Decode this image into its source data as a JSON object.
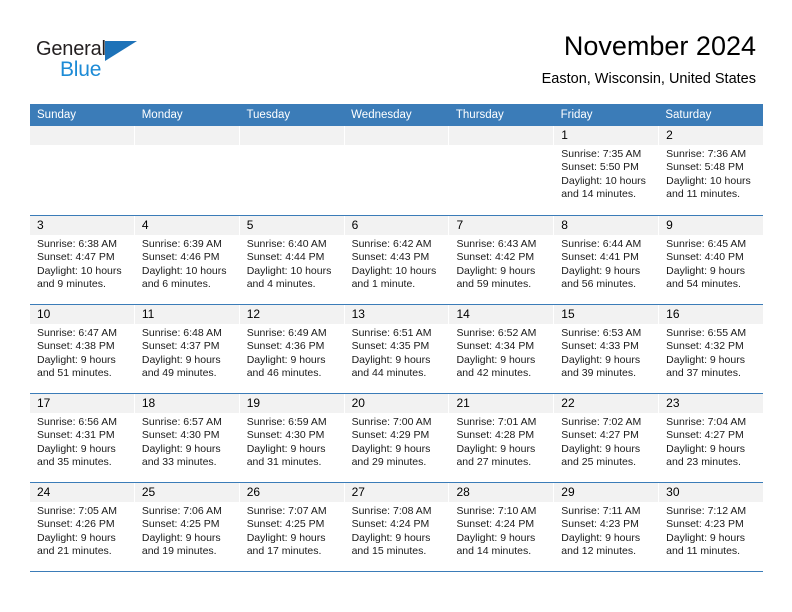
{
  "brand": {
    "name_dark": "General",
    "name_blue": "Blue",
    "accent_color": "#1d8bd6",
    "header_color": "#3b7cb8"
  },
  "header": {
    "title": "November 2024",
    "subtitle": "Easton, Wisconsin, United States"
  },
  "calendar": {
    "weekdays": [
      "Sunday",
      "Monday",
      "Tuesday",
      "Wednesday",
      "Thursday",
      "Friday",
      "Saturday"
    ],
    "weeks": [
      [
        {
          "day": "",
          "sunrise": "",
          "sunset": "",
          "daylight": ""
        },
        {
          "day": "",
          "sunrise": "",
          "sunset": "",
          "daylight": ""
        },
        {
          "day": "",
          "sunrise": "",
          "sunset": "",
          "daylight": ""
        },
        {
          "day": "",
          "sunrise": "",
          "sunset": "",
          "daylight": ""
        },
        {
          "day": "",
          "sunrise": "",
          "sunset": "",
          "daylight": ""
        },
        {
          "day": "1",
          "sunrise": "Sunrise: 7:35 AM",
          "sunset": "Sunset: 5:50 PM",
          "daylight": "Daylight: 10 hours and 14 minutes."
        },
        {
          "day": "2",
          "sunrise": "Sunrise: 7:36 AM",
          "sunset": "Sunset: 5:48 PM",
          "daylight": "Daylight: 10 hours and 11 minutes."
        }
      ],
      [
        {
          "day": "3",
          "sunrise": "Sunrise: 6:38 AM",
          "sunset": "Sunset: 4:47 PM",
          "daylight": "Daylight: 10 hours and 9 minutes."
        },
        {
          "day": "4",
          "sunrise": "Sunrise: 6:39 AM",
          "sunset": "Sunset: 4:46 PM",
          "daylight": "Daylight: 10 hours and 6 minutes."
        },
        {
          "day": "5",
          "sunrise": "Sunrise: 6:40 AM",
          "sunset": "Sunset: 4:44 PM",
          "daylight": "Daylight: 10 hours and 4 minutes."
        },
        {
          "day": "6",
          "sunrise": "Sunrise: 6:42 AM",
          "sunset": "Sunset: 4:43 PM",
          "daylight": "Daylight: 10 hours and 1 minute."
        },
        {
          "day": "7",
          "sunrise": "Sunrise: 6:43 AM",
          "sunset": "Sunset: 4:42 PM",
          "daylight": "Daylight: 9 hours and 59 minutes."
        },
        {
          "day": "8",
          "sunrise": "Sunrise: 6:44 AM",
          "sunset": "Sunset: 4:41 PM",
          "daylight": "Daylight: 9 hours and 56 minutes."
        },
        {
          "day": "9",
          "sunrise": "Sunrise: 6:45 AM",
          "sunset": "Sunset: 4:40 PM",
          "daylight": "Daylight: 9 hours and 54 minutes."
        }
      ],
      [
        {
          "day": "10",
          "sunrise": "Sunrise: 6:47 AM",
          "sunset": "Sunset: 4:38 PM",
          "daylight": "Daylight: 9 hours and 51 minutes."
        },
        {
          "day": "11",
          "sunrise": "Sunrise: 6:48 AM",
          "sunset": "Sunset: 4:37 PM",
          "daylight": "Daylight: 9 hours and 49 minutes."
        },
        {
          "day": "12",
          "sunrise": "Sunrise: 6:49 AM",
          "sunset": "Sunset: 4:36 PM",
          "daylight": "Daylight: 9 hours and 46 minutes."
        },
        {
          "day": "13",
          "sunrise": "Sunrise: 6:51 AM",
          "sunset": "Sunset: 4:35 PM",
          "daylight": "Daylight: 9 hours and 44 minutes."
        },
        {
          "day": "14",
          "sunrise": "Sunrise: 6:52 AM",
          "sunset": "Sunset: 4:34 PM",
          "daylight": "Daylight: 9 hours and 42 minutes."
        },
        {
          "day": "15",
          "sunrise": "Sunrise: 6:53 AM",
          "sunset": "Sunset: 4:33 PM",
          "daylight": "Daylight: 9 hours and 39 minutes."
        },
        {
          "day": "16",
          "sunrise": "Sunrise: 6:55 AM",
          "sunset": "Sunset: 4:32 PM",
          "daylight": "Daylight: 9 hours and 37 minutes."
        }
      ],
      [
        {
          "day": "17",
          "sunrise": "Sunrise: 6:56 AM",
          "sunset": "Sunset: 4:31 PM",
          "daylight": "Daylight: 9 hours and 35 minutes."
        },
        {
          "day": "18",
          "sunrise": "Sunrise: 6:57 AM",
          "sunset": "Sunset: 4:30 PM",
          "daylight": "Daylight: 9 hours and 33 minutes."
        },
        {
          "day": "19",
          "sunrise": "Sunrise: 6:59 AM",
          "sunset": "Sunset: 4:30 PM",
          "daylight": "Daylight: 9 hours and 31 minutes."
        },
        {
          "day": "20",
          "sunrise": "Sunrise: 7:00 AM",
          "sunset": "Sunset: 4:29 PM",
          "daylight": "Daylight: 9 hours and 29 minutes."
        },
        {
          "day": "21",
          "sunrise": "Sunrise: 7:01 AM",
          "sunset": "Sunset: 4:28 PM",
          "daylight": "Daylight: 9 hours and 27 minutes."
        },
        {
          "day": "22",
          "sunrise": "Sunrise: 7:02 AM",
          "sunset": "Sunset: 4:27 PM",
          "daylight": "Daylight: 9 hours and 25 minutes."
        },
        {
          "day": "23",
          "sunrise": "Sunrise: 7:04 AM",
          "sunset": "Sunset: 4:27 PM",
          "daylight": "Daylight: 9 hours and 23 minutes."
        }
      ],
      [
        {
          "day": "24",
          "sunrise": "Sunrise: 7:05 AM",
          "sunset": "Sunset: 4:26 PM",
          "daylight": "Daylight: 9 hours and 21 minutes."
        },
        {
          "day": "25",
          "sunrise": "Sunrise: 7:06 AM",
          "sunset": "Sunset: 4:25 PM",
          "daylight": "Daylight: 9 hours and 19 minutes."
        },
        {
          "day": "26",
          "sunrise": "Sunrise: 7:07 AM",
          "sunset": "Sunset: 4:25 PM",
          "daylight": "Daylight: 9 hours and 17 minutes."
        },
        {
          "day": "27",
          "sunrise": "Sunrise: 7:08 AM",
          "sunset": "Sunset: 4:24 PM",
          "daylight": "Daylight: 9 hours and 15 minutes."
        },
        {
          "day": "28",
          "sunrise": "Sunrise: 7:10 AM",
          "sunset": "Sunset: 4:24 PM",
          "daylight": "Daylight: 9 hours and 14 minutes."
        },
        {
          "day": "29",
          "sunrise": "Sunrise: 7:11 AM",
          "sunset": "Sunset: 4:23 PM",
          "daylight": "Daylight: 9 hours and 12 minutes."
        },
        {
          "day": "30",
          "sunrise": "Sunrise: 7:12 AM",
          "sunset": "Sunset: 4:23 PM",
          "daylight": "Daylight: 9 hours and 11 minutes."
        }
      ]
    ]
  }
}
